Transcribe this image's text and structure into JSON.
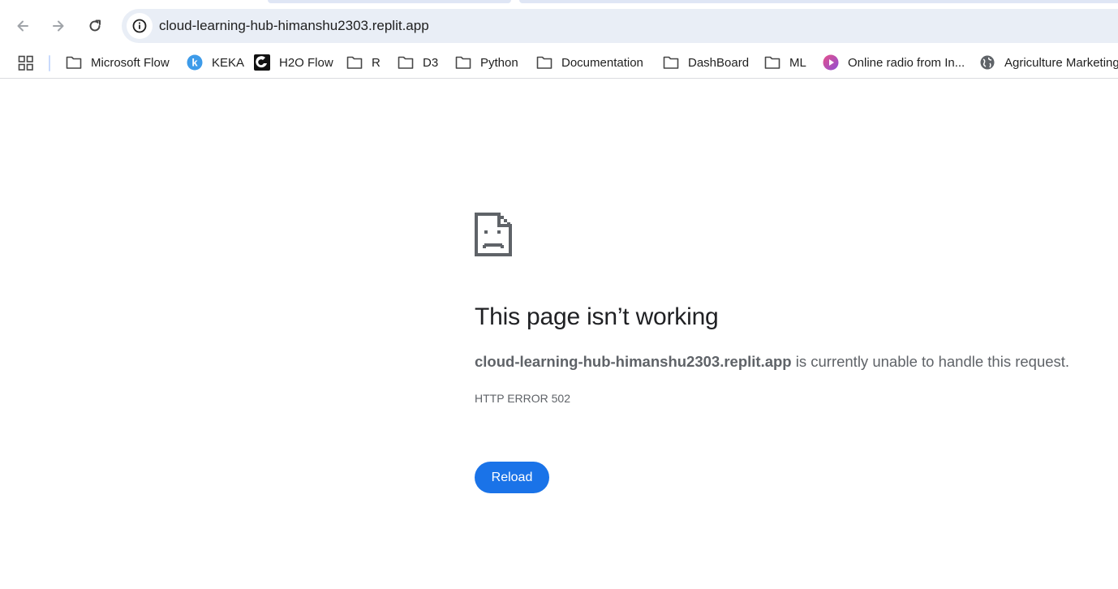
{
  "browser": {
    "url": "cloud-learning-hub-himanshu2303.replit.app",
    "nav": {
      "back_icon": "arrow-left-icon",
      "forward_icon": "arrow-right-icon",
      "reload_icon": "reload-icon",
      "site_info_icon": "info-icon"
    },
    "bookmarks": [
      {
        "label": "Microsoft Flow",
        "icon": "folder-icon"
      },
      {
        "label": "KEKA",
        "icon": "keka-logo-icon"
      },
      {
        "label": "H2O Flow",
        "icon": "h2o-logo-icon"
      },
      {
        "label": "R",
        "icon": "folder-icon"
      },
      {
        "label": "D3",
        "icon": "folder-icon"
      },
      {
        "label": "Python",
        "icon": "folder-icon"
      },
      {
        "label": "Documentation",
        "icon": "folder-icon"
      },
      {
        "label": "DashBoard",
        "icon": "folder-icon"
      },
      {
        "label": "ML",
        "icon": "folder-icon"
      },
      {
        "label": "Online radio from In...",
        "icon": "radio-play-icon"
      },
      {
        "label": "Agriculture Marketing",
        "icon": "globe-icon"
      }
    ]
  },
  "error_page": {
    "icon": "sad-page-icon",
    "title": "This page isn’t working",
    "host": "cloud-learning-hub-himanshu2303.replit.app",
    "message": " is currently unable to handle this request.",
    "code": "HTTP ERROR 502",
    "reload_label": "Reload"
  },
  "colors": {
    "accent": "#1a73e8",
    "omnibox_bg": "#e9eef6",
    "text_secondary": "#5f6368"
  }
}
